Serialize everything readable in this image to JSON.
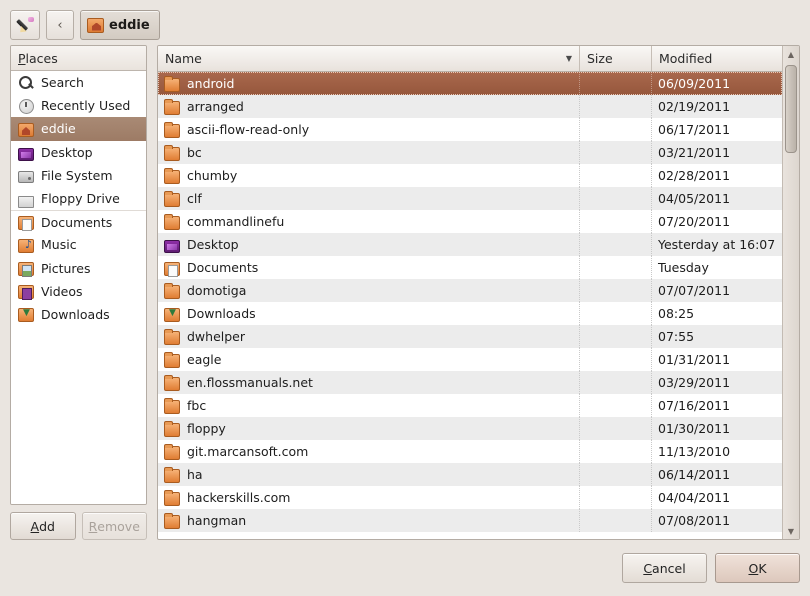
{
  "toolbar": {
    "edit_icon": "pencil-icon",
    "back_label": "‹",
    "breadcrumb_label": "eddie",
    "breadcrumb_icon": "home-folder-icon"
  },
  "sidebar": {
    "header": "Places",
    "header_mnemonic": "P",
    "items": [
      {
        "label": "Search",
        "icon": "search-icon",
        "selected": false,
        "separator": false
      },
      {
        "label": "Recently Used",
        "icon": "clock-icon",
        "selected": false,
        "separator": false
      },
      {
        "label": "eddie",
        "icon": "home-folder-icon",
        "selected": true,
        "separator": false
      },
      {
        "label": "Desktop",
        "icon": "desktop-icon",
        "selected": false,
        "separator": false
      },
      {
        "label": "File System",
        "icon": "hard-drive-icon",
        "selected": false,
        "separator": false
      },
      {
        "label": "Floppy Drive",
        "icon": "floppy-disk-icon",
        "selected": false,
        "separator": false
      },
      {
        "label": "Documents",
        "icon": "documents-icon",
        "selected": false,
        "separator": true
      },
      {
        "label": "Music",
        "icon": "music-folder-icon",
        "selected": false,
        "separator": false
      },
      {
        "label": "Pictures",
        "icon": "pictures-folder-icon",
        "selected": false,
        "separator": false
      },
      {
        "label": "Videos",
        "icon": "videos-folder-icon",
        "selected": false,
        "separator": false
      },
      {
        "label": "Downloads",
        "icon": "downloads-folder-icon",
        "selected": false,
        "separator": false
      }
    ],
    "add_label": "Add",
    "add_mnemonic": "A",
    "remove_label": "Remove",
    "remove_mnemonic": "R",
    "remove_disabled": true
  },
  "filelist": {
    "columns": {
      "name": "Name",
      "size": "Size",
      "modified": "Modified"
    },
    "sort_column": "Name",
    "sort_indicator": "descending-chevron-icon",
    "rows": [
      {
        "name": "android",
        "size": "",
        "modified": "06/09/2011",
        "icon": "folder-icon",
        "selected": true
      },
      {
        "name": "arranged",
        "size": "",
        "modified": "02/19/2011",
        "icon": "folder-icon",
        "selected": false
      },
      {
        "name": "ascii-flow-read-only",
        "size": "",
        "modified": "06/17/2011",
        "icon": "folder-icon",
        "selected": false
      },
      {
        "name": "bc",
        "size": "",
        "modified": "03/21/2011",
        "icon": "folder-icon",
        "selected": false
      },
      {
        "name": "chumby",
        "size": "",
        "modified": "02/28/2011",
        "icon": "folder-icon",
        "selected": false
      },
      {
        "name": "clf",
        "size": "",
        "modified": "04/05/2011",
        "icon": "folder-icon",
        "selected": false
      },
      {
        "name": "commandlinefu",
        "size": "",
        "modified": "07/20/2011",
        "icon": "folder-icon",
        "selected": false
      },
      {
        "name": "Desktop",
        "size": "",
        "modified": "Yesterday at 16:07",
        "icon": "desktop-icon",
        "selected": false
      },
      {
        "name": "Documents",
        "size": "",
        "modified": "Tuesday",
        "icon": "documents-icon",
        "selected": false
      },
      {
        "name": "domotiga",
        "size": "",
        "modified": "07/07/2011",
        "icon": "folder-icon",
        "selected": false
      },
      {
        "name": "Downloads",
        "size": "",
        "modified": "08:25",
        "icon": "downloads-folder-icon",
        "selected": false
      },
      {
        "name": "dwhelper",
        "size": "",
        "modified": "07:55",
        "icon": "folder-icon",
        "selected": false
      },
      {
        "name": "eagle",
        "size": "",
        "modified": "01/31/2011",
        "icon": "folder-icon",
        "selected": false
      },
      {
        "name": "en.flossmanuals.net",
        "size": "",
        "modified": "03/29/2011",
        "icon": "folder-icon",
        "selected": false
      },
      {
        "name": "fbc",
        "size": "",
        "modified": "07/16/2011",
        "icon": "folder-icon",
        "selected": false
      },
      {
        "name": "floppy",
        "size": "",
        "modified": "01/30/2011",
        "icon": "folder-icon",
        "selected": false
      },
      {
        "name": "git.marcansoft.com",
        "size": "",
        "modified": "11/13/2010",
        "icon": "folder-icon",
        "selected": false
      },
      {
        "name": "ha",
        "size": "",
        "modified": "06/14/2011",
        "icon": "folder-icon",
        "selected": false
      },
      {
        "name": "hackerskills.com",
        "size": "",
        "modified": "04/04/2011",
        "icon": "folder-icon",
        "selected": false
      },
      {
        "name": "hangman",
        "size": "",
        "modified": "07/08/2011",
        "icon": "folder-icon",
        "selected": false
      }
    ],
    "scrollbar": {
      "up_arrow": "▲",
      "down_arrow": "▼"
    }
  },
  "footer": {
    "cancel_label": "Cancel",
    "cancel_mnemonic": "C",
    "ok_label": "OK",
    "ok_mnemonic": "O",
    "default_button": "OK"
  },
  "colors": {
    "selection": "#a1624a",
    "sidebar_selection": "#a1816c",
    "window_bg": "#eae5e0",
    "list_bg": "#ffffff",
    "list_alt_bg": "#ececec"
  }
}
